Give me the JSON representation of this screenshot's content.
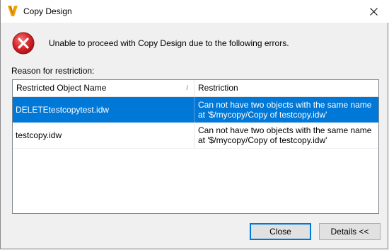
{
  "window": {
    "title": "Copy Design",
    "close_glyph": "✕"
  },
  "message": "Unable to proceed with Copy Design due to the following errors.",
  "reason_label": "Reason for restriction:",
  "table": {
    "columns": [
      "Restricted Object Name",
      "Restriction"
    ],
    "sort_indicator": "/",
    "rows": [
      {
        "name": "DELETEtestcopytest.idw",
        "restriction_line1": "Can not have two objects with the same name",
        "restriction_line2": "at '$/mycopy/Copy of testcopy.idw'",
        "selected": true
      },
      {
        "name": "testcopy.idw",
        "restriction_line1": "Can not have two objects with the same name",
        "restriction_line2": "at '$/mycopy/Copy of testcopy.idw'",
        "selected": false
      }
    ]
  },
  "buttons": {
    "close": "Close",
    "details": "Details <<"
  },
  "colors": {
    "selection": "#0078d7",
    "error_red": "#d9262b",
    "app_icon": "#f0a30a"
  },
  "icons": {
    "app": "vault-app-icon",
    "error": "error-icon",
    "close": "close-icon"
  }
}
